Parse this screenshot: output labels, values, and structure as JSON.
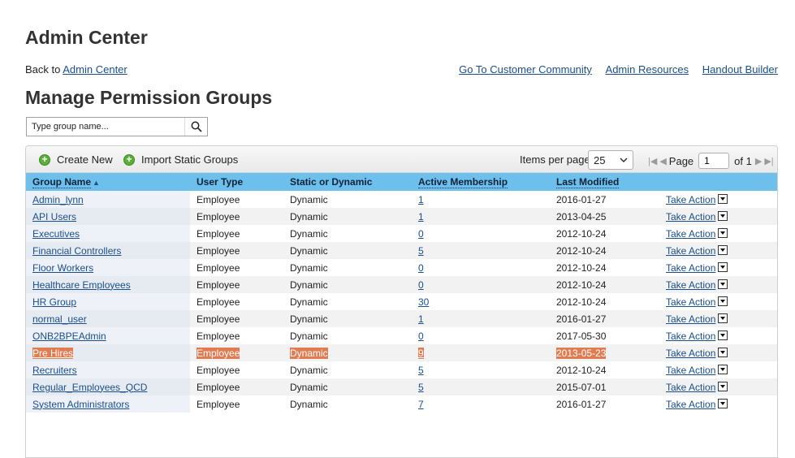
{
  "page": {
    "title": "Admin Center",
    "back_prefix": "Back to",
    "back_link": "Admin Center",
    "subtitle": "Manage Permission Groups"
  },
  "top_links": [
    "Go To Customer Community",
    "Admin Resources",
    "Handout Builder"
  ],
  "search": {
    "placeholder": "Type group name...",
    "icon": "search-icon"
  },
  "toolbar": {
    "create_new": "Create New",
    "import_static": "Import Static Groups",
    "items_per_page_label": "Items per page",
    "items_per_page_value": "25",
    "page_label": "Page",
    "page_value": "1",
    "page_total": "of 1"
  },
  "table": {
    "columns": [
      "Group Name",
      "User Type",
      "Static or Dynamic",
      "Active Membership",
      "Last Modified"
    ],
    "action_label": "Take Action",
    "rows": [
      {
        "name": "Admin_lynn",
        "type": "Employee",
        "mode": "Dynamic",
        "members": "1",
        "modified": "2016-01-27"
      },
      {
        "name": "API Users",
        "type": "Employee",
        "mode": "Dynamic",
        "members": "1",
        "modified": "2013-04-25"
      },
      {
        "name": "Executives",
        "type": "Employee",
        "mode": "Dynamic",
        "members": "0",
        "modified": "2012-10-24"
      },
      {
        "name": "Financial Controllers",
        "type": "Employee",
        "mode": "Dynamic",
        "members": "5",
        "modified": "2012-10-24"
      },
      {
        "name": "Floor Workers",
        "type": "Employee",
        "mode": "Dynamic",
        "members": "0",
        "modified": "2012-10-24"
      },
      {
        "name": "Healthcare Employees",
        "type": "Employee",
        "mode": "Dynamic",
        "members": "0",
        "modified": "2012-10-24"
      },
      {
        "name": "HR Group",
        "type": "Employee",
        "mode": "Dynamic",
        "members": "30",
        "modified": "2012-10-24"
      },
      {
        "name": "normal_user",
        "type": "Employee",
        "mode": "Dynamic",
        "members": "1",
        "modified": "2016-01-27"
      },
      {
        "name": "ONB2BPEAdmin",
        "type": "Employee",
        "mode": "Dynamic",
        "members": "0",
        "modified": "2017-05-30"
      },
      {
        "name": "Pre Hires",
        "type": "Employee",
        "mode": "Dynamic",
        "members": "9",
        "modified": "2013-05-23"
      },
      {
        "name": "Recruiters",
        "type": "Employee",
        "mode": "Dynamic",
        "members": "5",
        "modified": "2012-10-24"
      },
      {
        "name": "Regular_Employees_QCD",
        "type": "Employee",
        "mode": "Dynamic",
        "members": "5",
        "modified": "2015-07-01"
      },
      {
        "name": "System Administrators",
        "type": "Employee",
        "mode": "Dynamic",
        "members": "7",
        "modified": "2016-01-27"
      }
    ]
  },
  "colors": {
    "header": "#6dc0ec",
    "selected_row": "#e07c52",
    "link": "#1a4f8a"
  }
}
